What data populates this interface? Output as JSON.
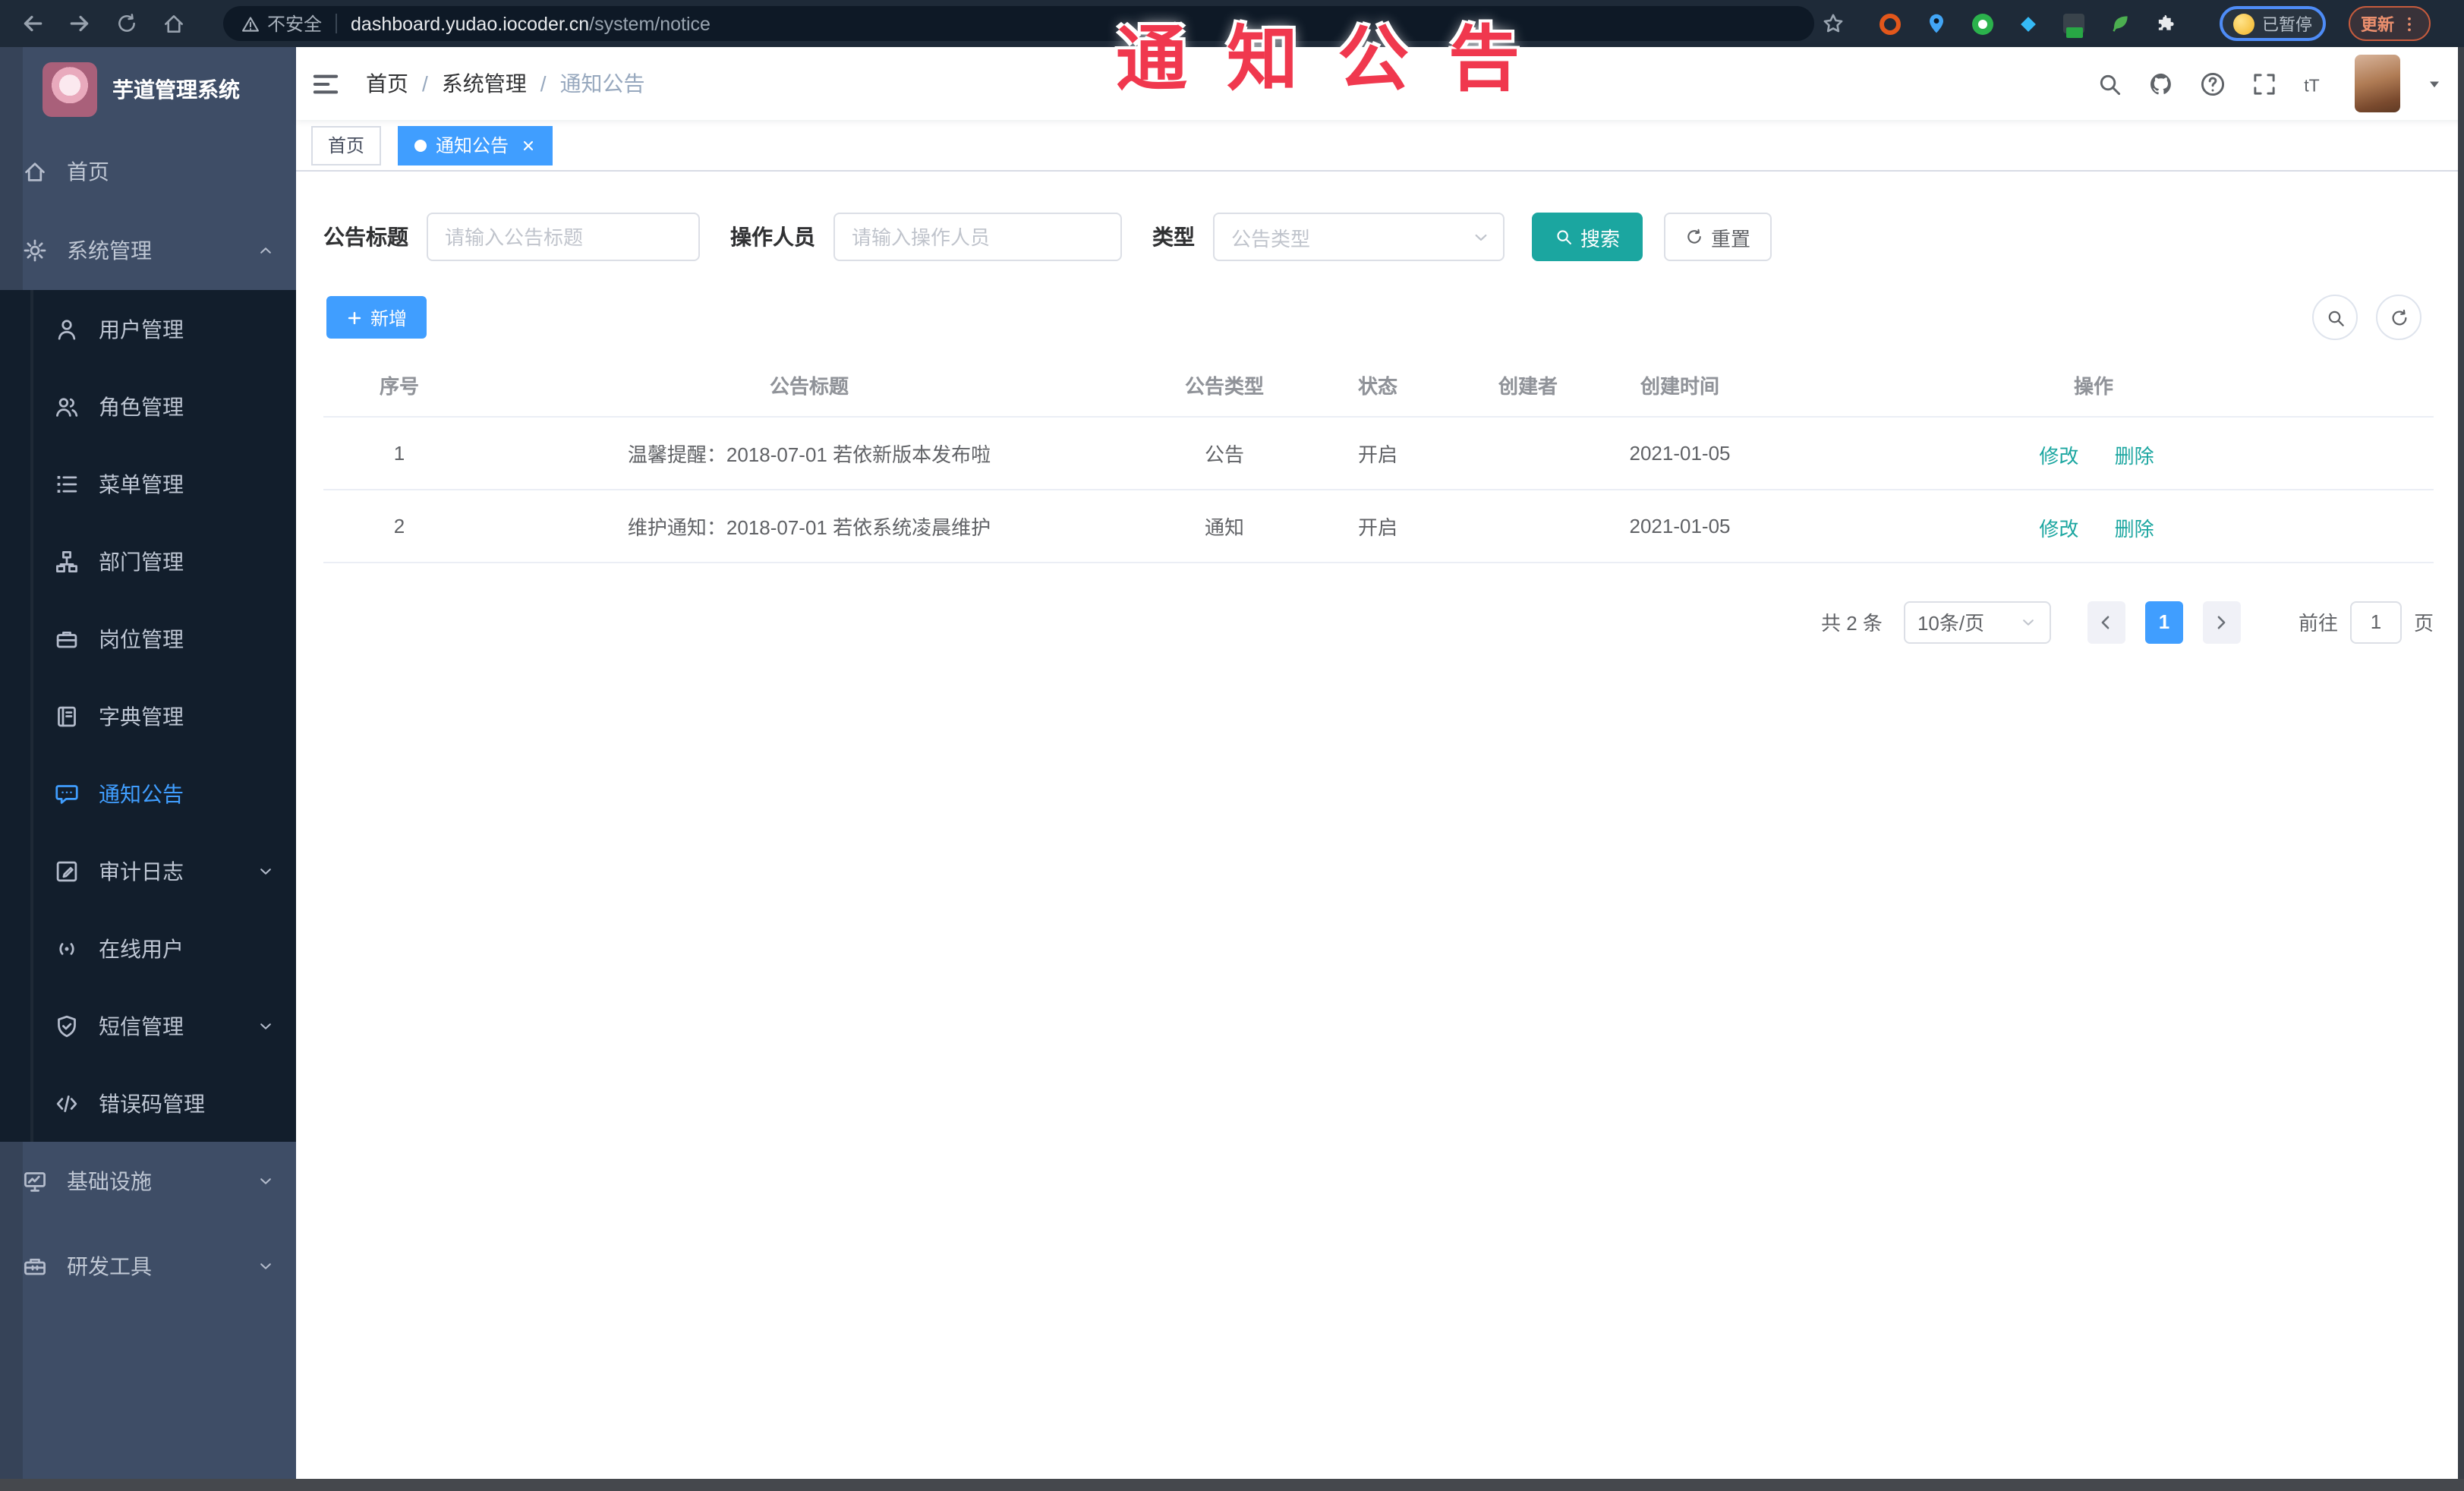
{
  "colors": {
    "accent_blue": "#409eff",
    "action_teal": "#1ba6a0",
    "overlay_red": "#f0384e",
    "sidebar_bg": "#3e4d66",
    "submenu_bg": "#121e2c",
    "chrome_bg": "#1e2a38",
    "tab_active_bg": "#409eff"
  },
  "browser": {
    "security_label": "不安全",
    "url_host": "dashboard.yudao.iocoder.cn",
    "url_path": "/system/notice",
    "profile_chip_label": "已暂停",
    "update_label": "更新",
    "icons": [
      "back-icon",
      "forward-icon",
      "reload-icon",
      "home-icon",
      "warning-icon",
      "bookmark-star-icon",
      "extension-icons",
      "profile-avatar",
      "kebab-menu-icon"
    ]
  },
  "overlay": {
    "text": "通知公告"
  },
  "sidebar": {
    "logo_title": "芋道管理系统",
    "items": [
      {
        "label": "首页",
        "icon": "home"
      },
      {
        "label": "系统管理",
        "icon": "gear",
        "chevron_icon": "chevron-up"
      },
      {
        "label": "用户管理",
        "icon": "user"
      },
      {
        "label": "角色管理",
        "icon": "users"
      },
      {
        "label": "菜单管理",
        "icon": "menu-list"
      },
      {
        "label": "部门管理",
        "icon": "tree"
      },
      {
        "label": "岗位管理",
        "icon": "briefcase"
      },
      {
        "label": "字典管理",
        "icon": "book"
      },
      {
        "label": "通知公告",
        "icon": "chat"
      },
      {
        "label": "审计日志",
        "icon": "edit-doc",
        "chevron_icon": "chevron-down"
      },
      {
        "label": "在线用户",
        "icon": "online"
      },
      {
        "label": "短信管理",
        "icon": "shield",
        "chevron_icon": "chevron-down"
      },
      {
        "label": "错误码管理",
        "icon": "code"
      },
      {
        "label": "基础设施",
        "icon": "monitor",
        "chevron_icon": "chevron-down"
      },
      {
        "label": "研发工具",
        "icon": "toolbox",
        "chevron_icon": "chevron-down"
      }
    ],
    "active_item": "通知公告"
  },
  "navbar": {
    "breadcrumb": [
      "首页",
      "系统管理",
      "通知公告"
    ],
    "separator": "/",
    "icons": [
      "hamburger-icon",
      "search-icon",
      "github-icon",
      "help-icon",
      "fullscreen-icon",
      "font-size-icon",
      "avatar",
      "caret-down-icon"
    ]
  },
  "tabs": [
    {
      "label": "首页",
      "active": false
    },
    {
      "label": "通知公告",
      "active": true
    }
  ],
  "filters": {
    "title_label": "公告标题",
    "title_placeholder": "请输入公告标题",
    "operator_label": "操作人员",
    "operator_placeholder": "请输入操作人员",
    "type_label": "类型",
    "type_placeholder": "公告类型",
    "search_label": "搜索",
    "reset_label": "重置"
  },
  "toolbar": {
    "add_label": "新增"
  },
  "table": {
    "columns": [
      "序号",
      "公告标题",
      "公告类型",
      "状态",
      "创建者",
      "创建时间",
      "操作"
    ],
    "rows": [
      {
        "index": "1",
        "title": "温馨提醒：2018-07-01 若依新版本发布啦",
        "type": "公告",
        "status": "开启",
        "creator": "",
        "created": "2021-01-05"
      },
      {
        "index": "2",
        "title": "维护通知：2018-07-01 若依系统凌晨维护",
        "type": "通知",
        "status": "开启",
        "creator": "",
        "created": "2021-01-05"
      }
    ],
    "edit_label": "修改",
    "delete_label": "删除"
  },
  "pagination": {
    "total_label": "共 2 条",
    "page_size_label": "10条/页",
    "page_current": "1",
    "goto_label": "前往",
    "goto_value": "1",
    "page_unit_label": "页"
  }
}
